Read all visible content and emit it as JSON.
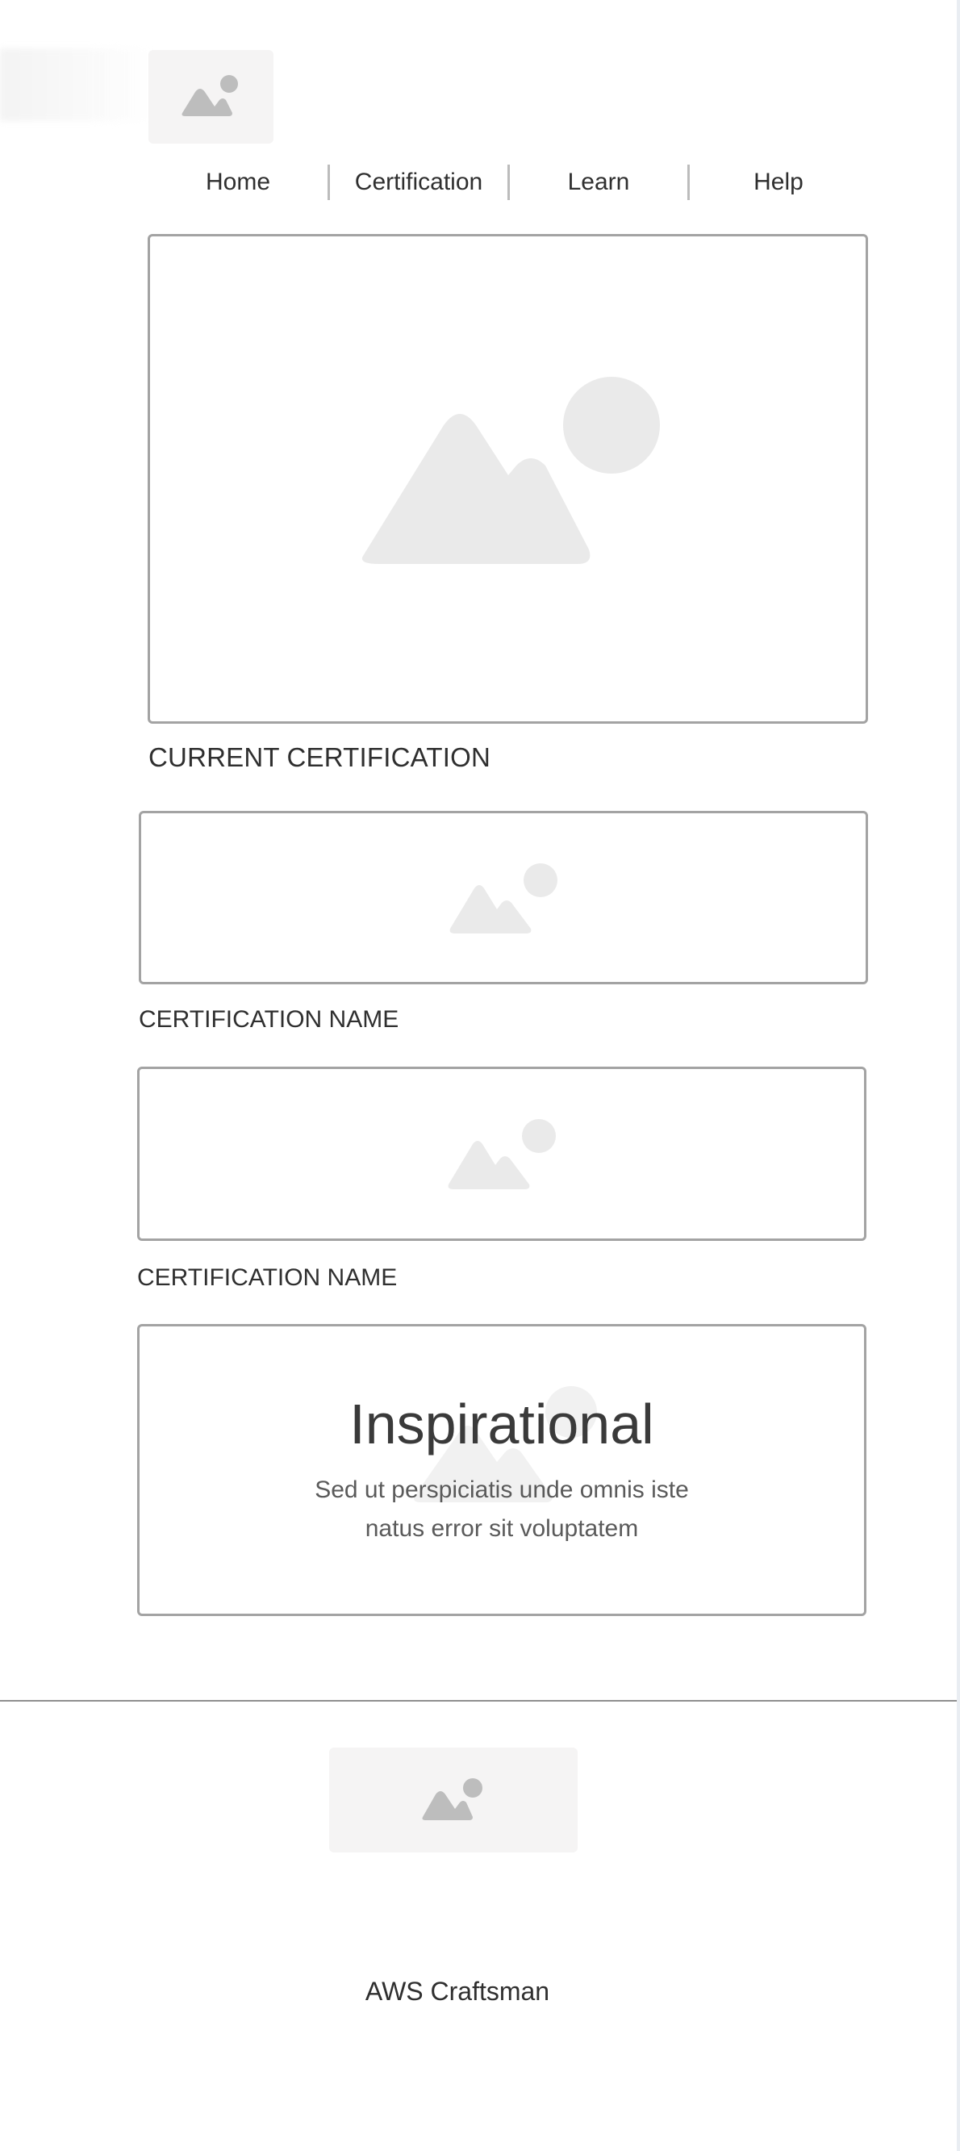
{
  "nav": {
    "items": [
      {
        "label": "Home"
      },
      {
        "label": "Certification"
      },
      {
        "label": "Learn"
      },
      {
        "label": "Help"
      }
    ]
  },
  "sections": {
    "current_certification": "CURRENT CERTIFICATION",
    "certification_name_1": "CERTIFICATION NAME",
    "certification_name_2": "CERTIFICATION NAME"
  },
  "inspirational": {
    "title": "Inspirational",
    "body": "Sed ut perspiciatis unde omnis iste natus error sit voluptatem"
  },
  "footer": {
    "text": "AWS Craftsman"
  },
  "icons": {
    "placeholder": "image-placeholder-icon"
  },
  "colors": {
    "border": "#a3a3a3",
    "placeholder_light": "#eaeaea",
    "placeholder_dark": "#bdbdbd",
    "text": "#2f2f2f"
  }
}
